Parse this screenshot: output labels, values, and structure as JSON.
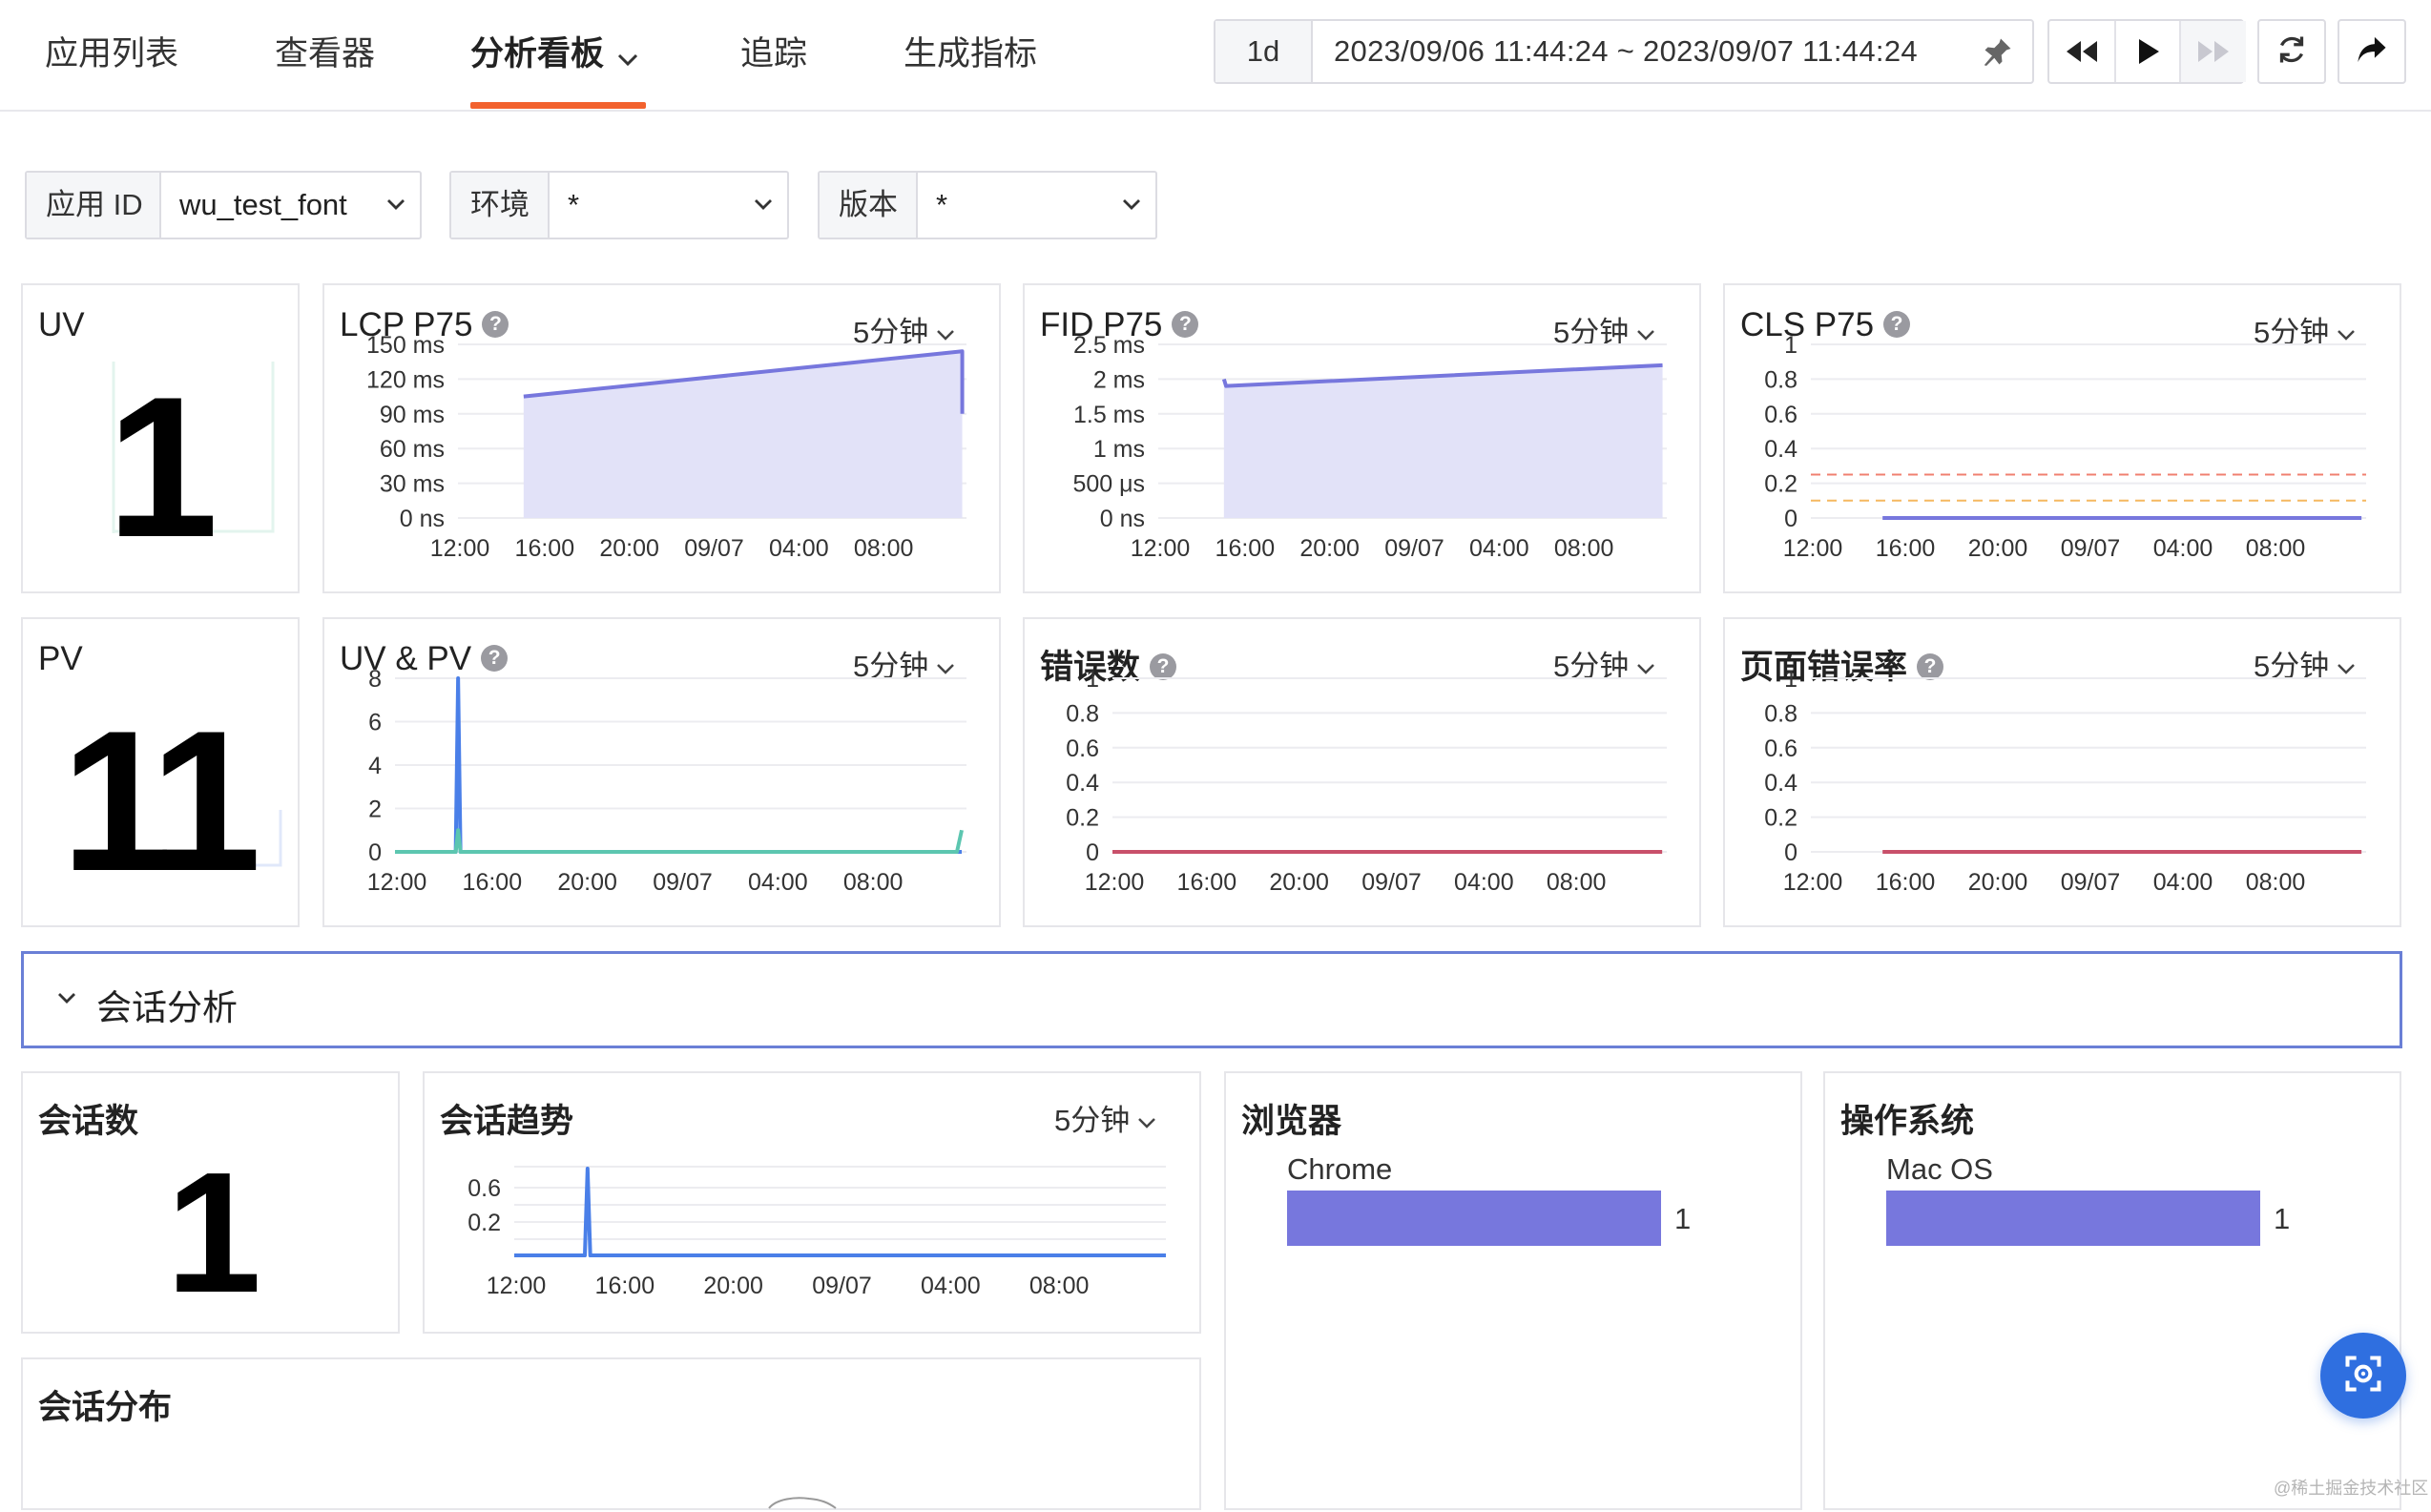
{
  "nav": {
    "tabs": [
      {
        "label": "应用列表"
      },
      {
        "label": "查看器"
      },
      {
        "label": "分析看板"
      },
      {
        "label": "追踪"
      },
      {
        "label": "生成指标"
      }
    ],
    "active_tab": "分析看板"
  },
  "time_range": {
    "preset": "1d",
    "range_text": "2023/09/06 11:44:24 ~ 2023/09/07 11:44:24"
  },
  "toolbar_icons": [
    "pin-icon",
    "rewind-icon",
    "play-icon",
    "fast-forward-icon",
    "refresh-icon",
    "share-icon"
  ],
  "filters": [
    {
      "label": "应用 ID",
      "value": "wu_test_font"
    },
    {
      "label": "环境",
      "value": "*"
    },
    {
      "label": "版本",
      "value": "*"
    }
  ],
  "x_ticks": [
    "12:00",
    "16:00",
    "20:00",
    "09/07",
    "04:00",
    "08:00"
  ],
  "cards": {
    "uv": {
      "title": "UV",
      "value": "1"
    },
    "pv": {
      "title": "PV",
      "value": "11"
    },
    "lcp": {
      "title": "LCP P75",
      "interval": "5分钟"
    },
    "fid": {
      "title": "FID P75",
      "interval": "5分钟"
    },
    "cls": {
      "title": "CLS P75",
      "interval": "5分钟"
    },
    "uvpv": {
      "title": "UV & PV",
      "interval": "5分钟"
    },
    "errors": {
      "title": "错误数",
      "interval": "5分钟"
    },
    "error_rate": {
      "title": "页面错误率",
      "interval": "5分钟"
    }
  },
  "session_section": {
    "title": "会话分析",
    "session_count": {
      "title": "会话数",
      "value": "1"
    },
    "session_trend": {
      "title": "会话趋势",
      "interval": "5分钟"
    },
    "browser": {
      "title": "浏览器",
      "items": [
        {
          "label": "Chrome",
          "value": 1
        }
      ]
    },
    "os": {
      "title": "操作系统",
      "items": [
        {
          "label": "Mac OS",
          "value": 1
        }
      ]
    },
    "distribution": {
      "title": "会话分布"
    }
  },
  "watermark": "@稀土掘金技术社区",
  "colors": {
    "accent_tab": "#f2622e",
    "series_purple": "#7777dd",
    "series_teal": "#5cc6b0",
    "series_blue": "#4a7fe8",
    "error_line": "#c8506a",
    "threshold_red": "#f08070",
    "threshold_orange": "#f5b860",
    "fab": "#2f6fe0"
  },
  "chart_data": [
    {
      "id": "lcp",
      "type": "area",
      "title": "LCP P75",
      "ylabels": [
        "150 ms",
        "120 ms",
        "90 ms",
        "60 ms",
        "30 ms",
        "0 ns"
      ],
      "ylim": [
        0,
        150
      ],
      "xlim": [
        0,
        24
      ],
      "series": [
        {
          "values": [
            [
              3.1,
              105
            ],
            [
              23.8,
              144
            ],
            [
              23.8,
              90
            ]
          ]
        }
      ]
    },
    {
      "id": "fid",
      "type": "area",
      "title": "FID P75",
      "ylabels": [
        "2.5 ms",
        "2 ms",
        "1.5 ms",
        "1 ms",
        "500 μs",
        "0 ns"
      ],
      "ylim": [
        0,
        2.5
      ],
      "xlim": [
        0,
        24
      ],
      "series": [
        {
          "values": [
            [
              3.1,
              2.0
            ],
            [
              3.2,
              1.9
            ],
            [
              23.8,
              2.2
            ]
          ]
        }
      ]
    },
    {
      "id": "cls",
      "type": "line",
      "title": "CLS P75",
      "ylabels": [
        "1",
        "0.8",
        "0.6",
        "0.4",
        "0.2",
        "0"
      ],
      "ylim": [
        0,
        1
      ],
      "xlim": [
        0,
        24
      ],
      "thresholds": [
        0.25,
        0.1
      ],
      "series": [
        {
          "values": [
            [
              3.1,
              0
            ],
            [
              23.8,
              0
            ]
          ]
        }
      ]
    },
    {
      "id": "uvpv",
      "type": "line",
      "title": "UV & PV",
      "ylabels": [
        "8",
        "6",
        "4",
        "2",
        "0"
      ],
      "ylim": [
        0,
        8
      ],
      "xlim": [
        0,
        24
      ],
      "series": [
        {
          "values": [
            [
              0,
              0
            ],
            [
              2.55,
              0
            ],
            [
              2.65,
              8
            ],
            [
              2.75,
              0
            ],
            [
              23.8,
              0
            ]
          ]
        },
        {
          "values": [
            [
              0,
              0
            ],
            [
              2.55,
              0
            ],
            [
              2.65,
              1
            ],
            [
              2.75,
              0
            ],
            [
              23.6,
              0
            ],
            [
              23.8,
              1
            ]
          ]
        }
      ]
    },
    {
      "id": "errors",
      "type": "line",
      "title": "错误数",
      "ylabels": [
        "1",
        "0.8",
        "0.6",
        "0.4",
        "0.2",
        "0"
      ],
      "ylim": [
        0,
        1
      ],
      "xlim": [
        0,
        24
      ],
      "series": [
        {
          "values": [
            [
              0,
              0
            ],
            [
              23.8,
              0
            ]
          ]
        }
      ]
    },
    {
      "id": "error_rate",
      "type": "line",
      "title": "页面错误率",
      "ylabels": [
        "1",
        "0.8",
        "0.6",
        "0.4",
        "0.2",
        "0"
      ],
      "ylim": [
        0,
        1
      ],
      "xlim": [
        0,
        24
      ],
      "series": [
        {
          "values": [
            [
              3.1,
              0
            ],
            [
              23.8,
              0
            ]
          ]
        }
      ]
    },
    {
      "id": "session_trend",
      "type": "line",
      "title": "会话趋势",
      "ylabels": [
        "0.6",
        "0.2"
      ],
      "ylim": [
        0,
        1
      ],
      "xlim": [
        0,
        24
      ],
      "series": [
        {
          "values": [
            [
              0,
              0
            ],
            [
              2.6,
              0
            ],
            [
              2.7,
              1
            ],
            [
              2.8,
              0
            ],
            [
              24,
              0
            ]
          ]
        }
      ]
    },
    {
      "id": "browser",
      "type": "bar",
      "title": "浏览器",
      "categories": [
        "Chrome"
      ],
      "values": [
        1
      ]
    },
    {
      "id": "os",
      "type": "bar",
      "title": "操作系统",
      "categories": [
        "Mac OS"
      ],
      "values": [
        1
      ]
    }
  ]
}
